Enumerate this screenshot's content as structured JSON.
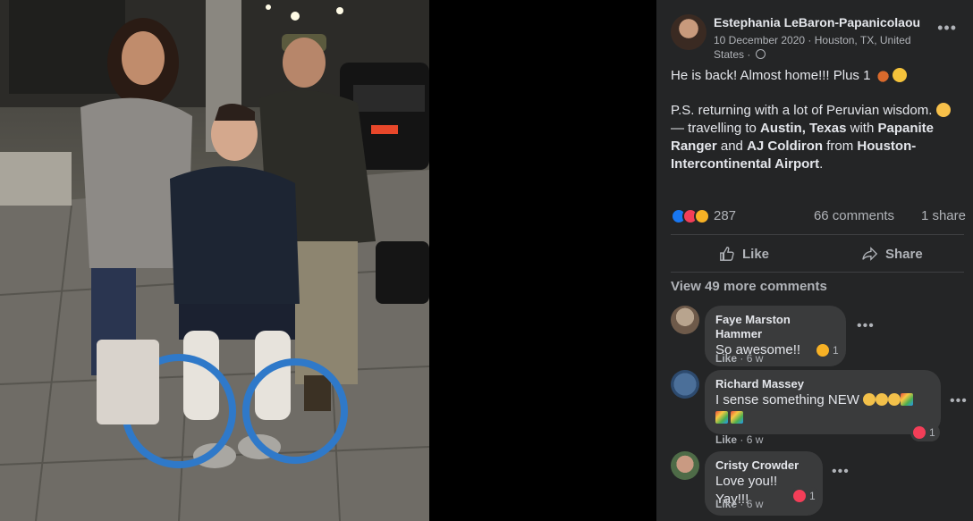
{
  "post": {
    "author": "Estephania LeBaron-Papanicolaou",
    "meta_line1": "10 December 2020 · Houston, TX, United",
    "meta_line2": "States ·",
    "line1": "He is back! Almost home!!! Plus 1",
    "line2": "P.S. returning with a lot of Peruvian wisdom.",
    "travel_prefix": "— travelling to ",
    "travel_dest": "Austin, Texas",
    "with": " with ",
    "tag1": "Papanite Ranger",
    "and": " and ",
    "tag2": "AJ Coldiron",
    "from": " from ",
    "origin": "Houston-Intercontinental Airport",
    "period": "."
  },
  "stats": {
    "reactions": "287",
    "comments": "66 comments",
    "shares": "1 share"
  },
  "actions": {
    "like": "Like",
    "share": "Share"
  },
  "view_more": "View 49 more comments",
  "comments": [
    {
      "name": "Faye Marston Hammer",
      "text": "So awesome!!",
      "like": "Like",
      "time": "6 w",
      "reaction_count": "1"
    },
    {
      "name": "Richard Massey",
      "text_line1": "I sense something NEW",
      "like": "Like",
      "time": "6 w",
      "reaction_count": "1"
    },
    {
      "name": "Cristy Crowder",
      "text": "Love you!! Yay!!!",
      "like": "Like",
      "time": "6 w",
      "reaction_count": "1"
    }
  ],
  "colors": {
    "panel_bg": "#242526",
    "bubble_bg": "#3a3b3c",
    "text_primary": "#e4e6eb",
    "text_secondary": "#b0b3b8",
    "like_blue": "#1877f2",
    "love_red": "#f33e58"
  },
  "icons": [
    "globe-icon",
    "more-options-icon",
    "like-thumb-icon",
    "share-arrow-icon"
  ]
}
